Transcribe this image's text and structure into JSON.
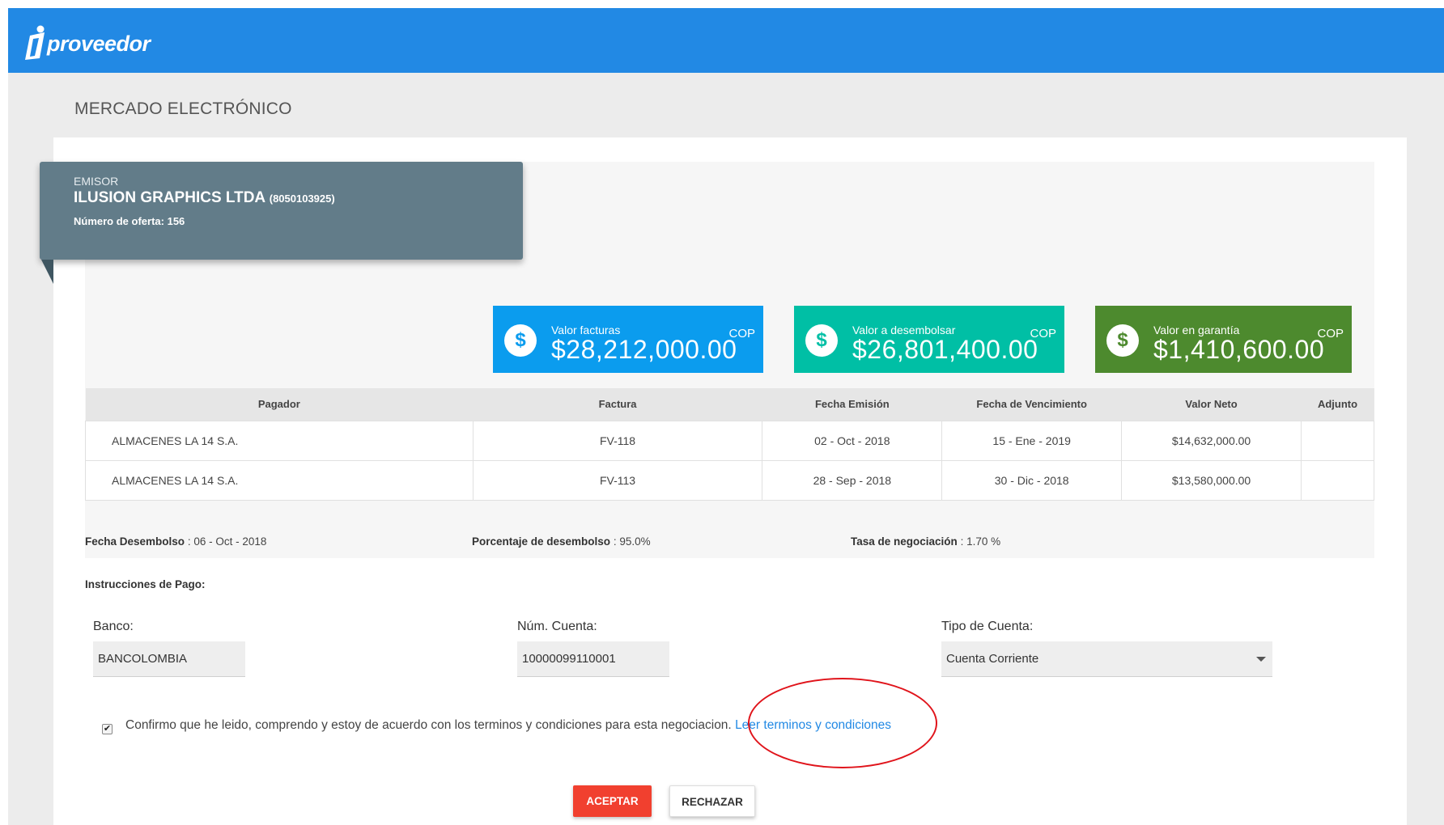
{
  "header": {
    "logo_text": "proveedor",
    "logo_letter": "i"
  },
  "page_title": "MERCADO ELECTRÓNICO",
  "emisor": {
    "label": "EMISOR",
    "name": "ILUSION GRAPHICS LTDA",
    "nit": "(8050103925)",
    "offer_label": "Número de oferta:",
    "offer_number": "156"
  },
  "stats": [
    {
      "label": "Valor facturas",
      "value": "$28,212,000.00",
      "currency": "COP",
      "color": "#0b9cee",
      "icon": "dollar-icon"
    },
    {
      "label": "Valor a desembolsar",
      "value": "$26,801,400.00",
      "currency": "COP",
      "color": "#00bfa5",
      "icon": "dollar-icon"
    },
    {
      "label": "Valor en garantía",
      "value": "$1,410,600.00",
      "currency": "COP",
      "color": "#4d8a2e",
      "icon": "dollar-icon"
    }
  ],
  "table": {
    "headers": [
      "Pagador",
      "Factura",
      "Fecha Emisión",
      "Fecha de Vencimiento",
      "Valor Neto",
      "Adjunto"
    ],
    "rows": [
      [
        "ALMACENES LA 14 S.A.",
        "FV-118",
        "02 - Oct - 2018",
        "15 - Ene - 2019",
        "$14,632,000.00",
        ""
      ],
      [
        "ALMACENES LA 14 S.A.",
        "FV-113",
        "28 - Sep - 2018",
        "30 - Dic - 2018",
        "$13,580,000.00",
        ""
      ]
    ]
  },
  "summary": {
    "fecha_label": "Fecha Desembolso",
    "fecha_value": ": 06 - Oct - 2018",
    "porcentaje_label": "Porcentaje de desembolso",
    "porcentaje_value": ": 95.0%",
    "tasa_label": "Tasa de negociación",
    "tasa_value": ": 1.70 %"
  },
  "payment": {
    "title": "Instrucciones de Pago:",
    "banco_label": "Banco:",
    "banco_value": "BANCOLOMBIA",
    "cuenta_label": "Núm. Cuenta:",
    "cuenta_value": "10000099110001",
    "tipo_label": "Tipo de Cuenta:",
    "tipo_value": "Cuenta Corriente"
  },
  "terms": {
    "checked": true,
    "text": "Confirmo que he leido, comprendo y estoy de acuerdo con los terminos y condiciones para esta negociacion.",
    "link": "Leer terminos y condiciones"
  },
  "buttons": {
    "accept": "ACEPTAR",
    "reject": "RECHAZAR"
  }
}
